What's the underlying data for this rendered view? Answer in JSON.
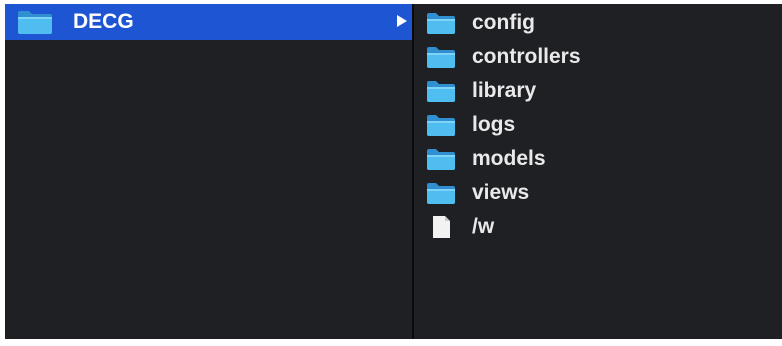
{
  "window": {
    "title": ""
  },
  "left_column": {
    "items": [
      {
        "label": "DECG",
        "icon": "folder-icon",
        "selected": true,
        "has_children": true
      }
    ]
  },
  "right_column": {
    "items": [
      {
        "label": "config",
        "icon": "folder-icon"
      },
      {
        "label": "controllers",
        "icon": "folder-icon"
      },
      {
        "label": "library",
        "icon": "folder-icon"
      },
      {
        "label": "logs",
        "icon": "folder-icon"
      },
      {
        "label": "models",
        "icon": "folder-icon"
      },
      {
        "label": "views",
        "icon": "folder-icon"
      },
      {
        "label": "/w",
        "icon": "file-icon"
      }
    ]
  },
  "colors": {
    "background": "#1f2023",
    "selection": "#1d55d3",
    "folder": "#49b6ea",
    "text": "#e9e9eb"
  }
}
